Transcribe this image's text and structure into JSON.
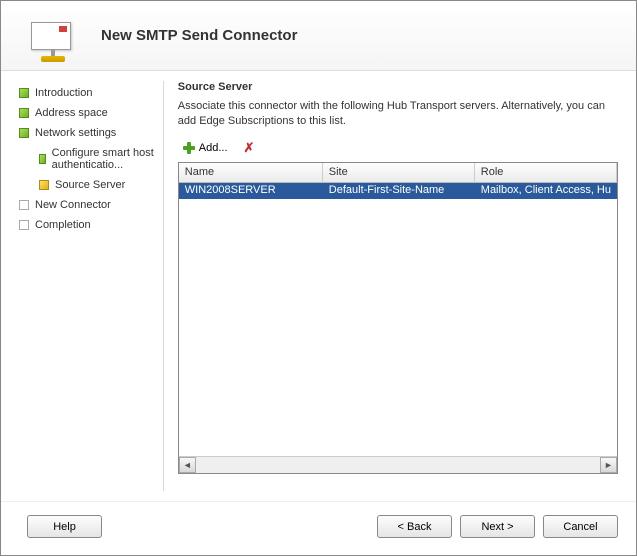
{
  "header": {
    "title": "New SMTP Send Connector"
  },
  "sidebar": {
    "items": [
      {
        "label": "Introduction",
        "icon": "green"
      },
      {
        "label": "Address space",
        "icon": "green"
      },
      {
        "label": "Network settings",
        "icon": "green"
      },
      {
        "label": "Configure smart host authenticatio...",
        "icon": "green",
        "sub": true
      },
      {
        "label": "Source Server",
        "icon": "yellow",
        "sub": true
      },
      {
        "label": "New Connector",
        "icon": "grey"
      },
      {
        "label": "Completion",
        "icon": "grey"
      }
    ]
  },
  "main": {
    "section_title": "Source Server",
    "description": "Associate this connector with the following Hub Transport servers. Alternatively, you can add Edge Subscriptions to this list.",
    "toolbar": {
      "add_label": "Add..."
    },
    "table": {
      "columns": [
        "Name",
        "Site",
        "Role"
      ],
      "rows": [
        {
          "name": "WIN2008SERVER",
          "site": "Default-First-Site-Name",
          "role": "Mailbox, Client Access, Hu"
        }
      ]
    }
  },
  "footer": {
    "help": "Help",
    "back": "< Back",
    "next": "Next >",
    "cancel": "Cancel"
  }
}
